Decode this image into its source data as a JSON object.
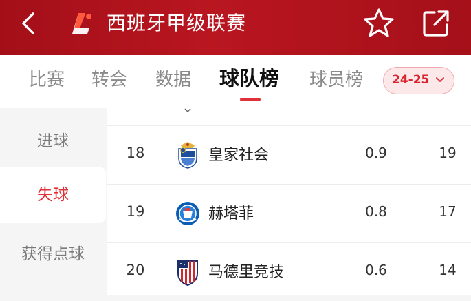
{
  "header": {
    "title": "西班牙甲级联赛",
    "bg_color": "#b5121b"
  },
  "tabs": [
    {
      "label": "比赛",
      "active": false
    },
    {
      "label": "转会",
      "active": false
    },
    {
      "label": "数据",
      "active": false
    },
    {
      "label": "球队榜",
      "active": true
    },
    {
      "label": "球员榜",
      "active": false
    }
  ],
  "season": {
    "label": "24-25"
  },
  "sidebar": {
    "items": [
      {
        "label": "进球",
        "active": false
      },
      {
        "label": "失球",
        "active": true
      },
      {
        "label": "获得点球",
        "active": false
      }
    ]
  },
  "table": {
    "rows": [
      {
        "rank": "18",
        "team": "皇家社会",
        "value1": "0.9",
        "value2": "19",
        "crest": "real-sociedad-crest"
      },
      {
        "rank": "19",
        "team": "赫塔菲",
        "value1": "0.8",
        "value2": "17",
        "crest": "getafe-crest"
      },
      {
        "rank": "20",
        "team": "马德里竞技",
        "value1": "0.6",
        "value2": "14",
        "crest": "atletico-madrid-crest"
      }
    ]
  },
  "colors": {
    "accent": "#e0313a",
    "season_bg": "#fde8e9"
  }
}
